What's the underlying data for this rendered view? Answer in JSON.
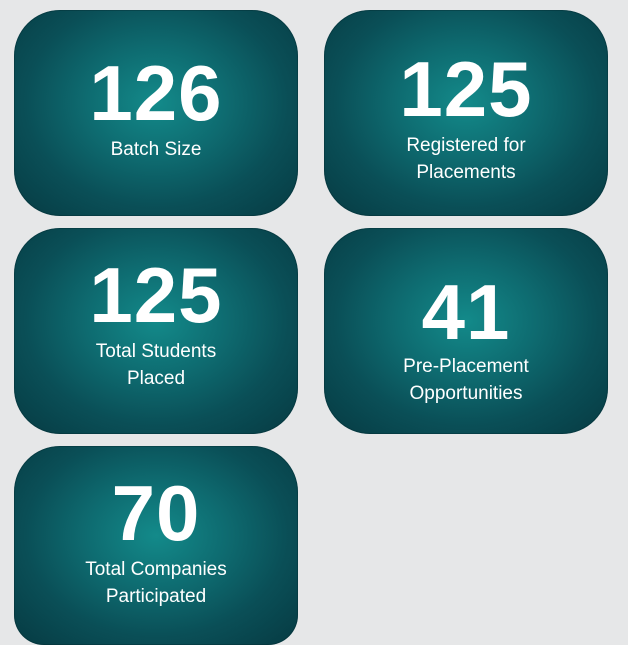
{
  "stats": [
    {
      "value": "126",
      "label_lines": [
        "Batch Size"
      ]
    },
    {
      "value": "125",
      "label_lines": [
        "Registered for",
        "Placements"
      ]
    },
    {
      "value": "125",
      "label_lines": [
        "Total Students",
        "Placed"
      ]
    },
    {
      "value": "41",
      "label_lines": [
        "Pre-Placement",
        "Opportunities"
      ]
    },
    {
      "value": "70",
      "label_lines": [
        "Total Companies",
        "Participated"
      ]
    }
  ],
  "colors": {
    "background": "#e6e7e8",
    "card_center": "#138a8a",
    "card_edge": "#063a42",
    "text": "#ffffff"
  }
}
